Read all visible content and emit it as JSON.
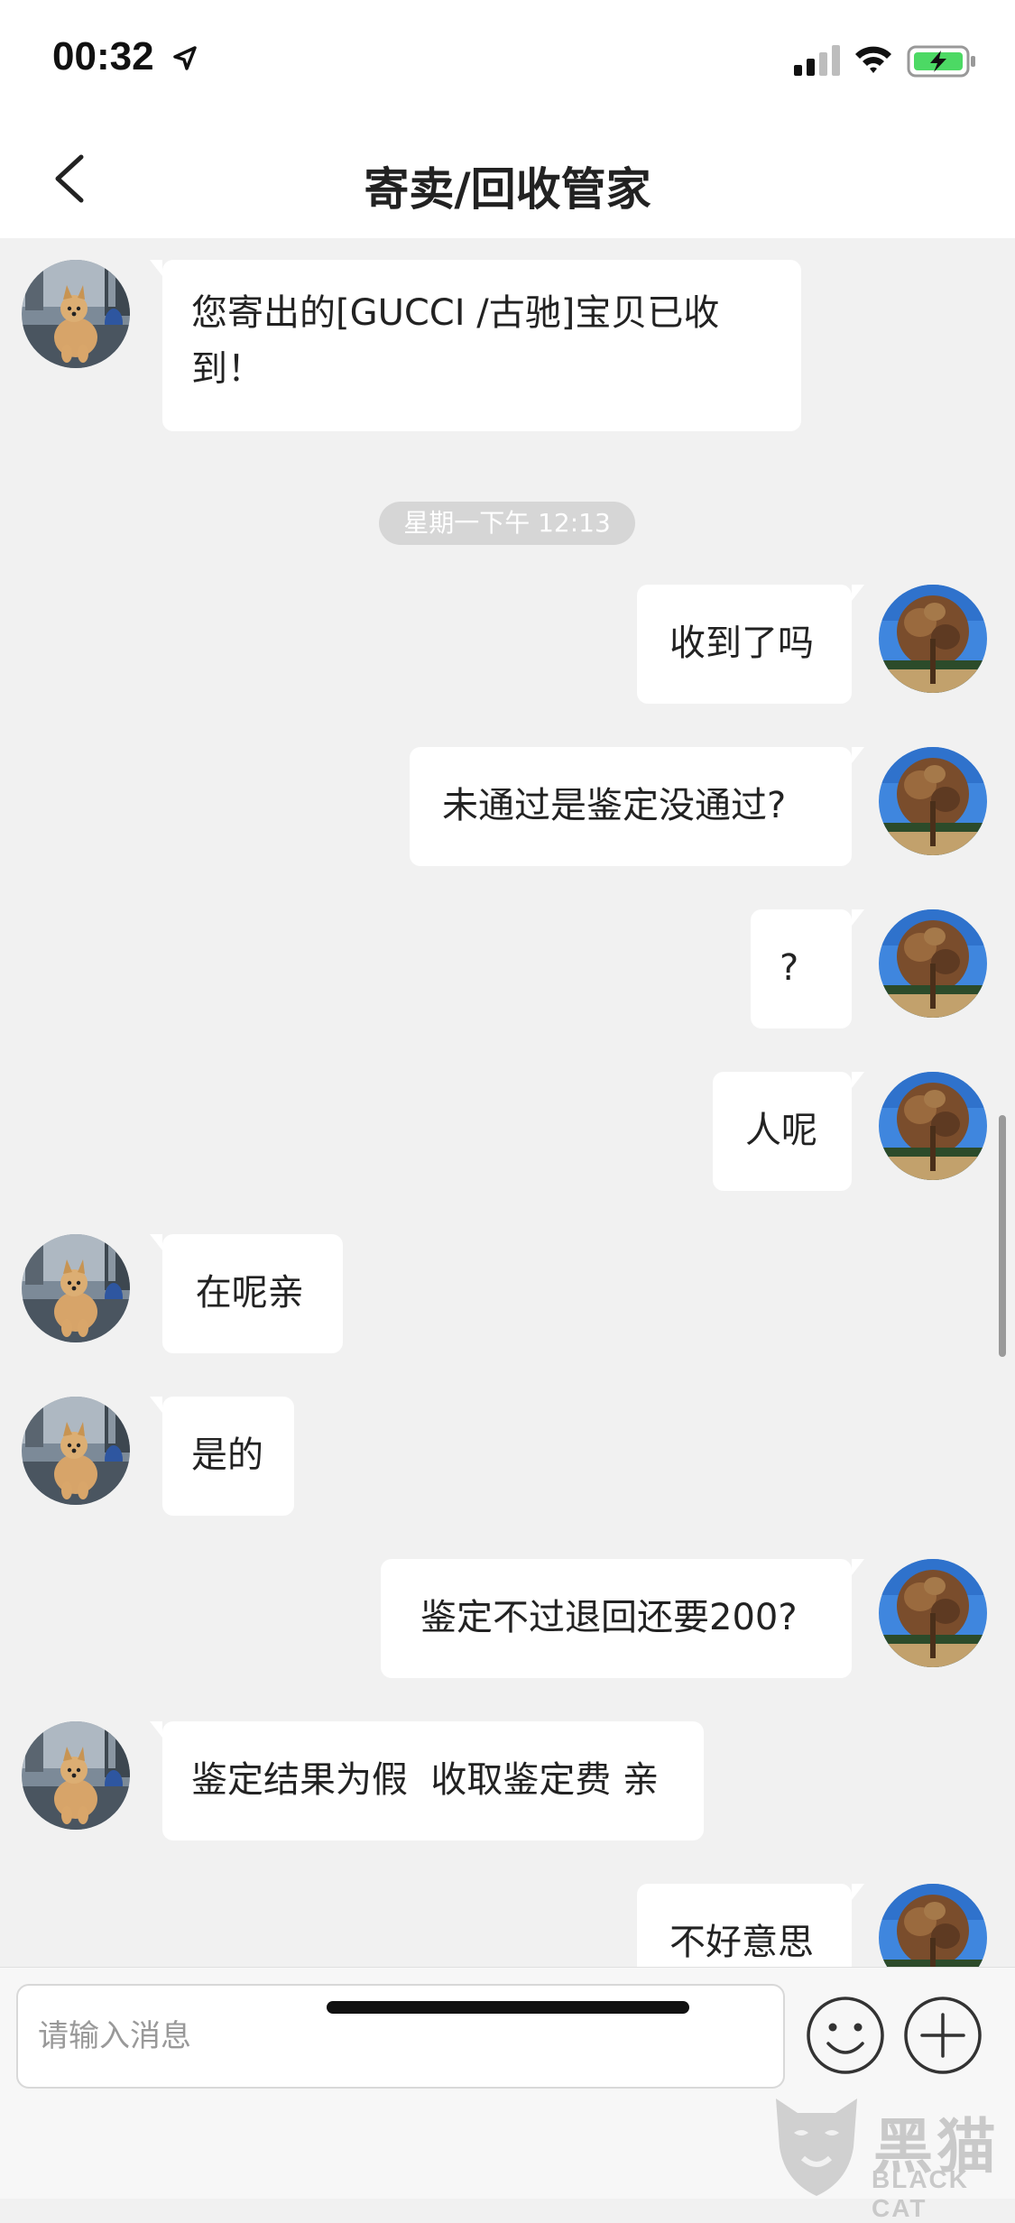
{
  "status_bar": {
    "time": "00:32",
    "location_icon": "location-arrow-icon",
    "signal_icon": "cellular-signal-icon",
    "wifi_icon": "wifi-icon",
    "battery_icon": "battery-charging-icon",
    "battery_color": "#4cd964"
  },
  "nav": {
    "back_icon": "chevron-left-icon",
    "title": "寄卖/回收管家"
  },
  "messages": [
    {
      "side": "left",
      "text_lines": [
        "您寄出的[GUCCI /古驰]宝贝已收",
        "到！"
      ]
    },
    {
      "side": "right",
      "text": "收到了吗"
    },
    {
      "side": "right",
      "text": "未通过是鉴定没通过?"
    },
    {
      "side": "right",
      "text": "?"
    },
    {
      "side": "right",
      "text": "人呢"
    },
    {
      "side": "left",
      "text": " 在呢亲"
    },
    {
      "side": "left",
      "text": "是的"
    },
    {
      "side": "right",
      "text": "鉴定不过退回还要200?"
    },
    {
      "side": "left",
      "text": "鉴定结果为假  收取鉴定费 亲"
    },
    {
      "side": "right",
      "text": "不好意思"
    }
  ],
  "timestamp": "星期一下午 12:13",
  "avatars": {
    "left": "dog-avatar",
    "right": "tree-avatar"
  },
  "input": {
    "placeholder": "请输入消息",
    "emoji_icon": "smiley-face-icon",
    "plus_icon": "plus-circle-icon"
  },
  "watermark": {
    "text": "黑猫",
    "sub": "BLACK CAT"
  },
  "colors": {
    "chat_background": "#f1f1f1",
    "bubble": "#ffffff",
    "timestamp_pill": "#d6d6d6"
  }
}
